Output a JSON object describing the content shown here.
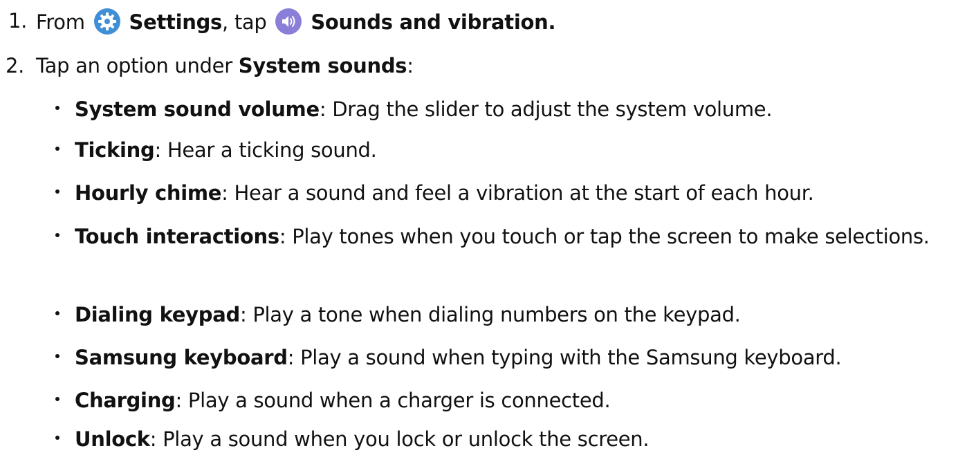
{
  "step1": {
    "number": "1.",
    "from_text": "From",
    "settings_label": "Settings",
    "tap_text": ", tap",
    "sounds_label": "Sounds and vibration.",
    "settings_icon": "gear-icon",
    "sounds_icon": "speaker-icon",
    "settings_icon_color": "#3f8fd6",
    "sounds_icon_color": "#8a7fd8"
  },
  "step2": {
    "number": "2.",
    "text": "Tap an option under ",
    "bold": "System sounds",
    "colon": ":"
  },
  "options": [
    {
      "term": "System sound volume",
      "desc": ": Drag the slider to adjust the system volume."
    },
    {
      "term": "Ticking",
      "desc": ": Hear a ticking sound."
    },
    {
      "term": "Hourly chime",
      "desc": ": Hear a sound and feel a vibration at the start of each hour."
    },
    {
      "term": "Touch interactions",
      "desc": ": Play tones when you touch or tap the screen to make selections."
    },
    {
      "term": "Dialing keypad",
      "desc": ": Play a tone when dialing numbers on the keypad."
    },
    {
      "term": "Samsung keyboard",
      "desc": ": Play a sound when typing with the Samsung keyboard."
    },
    {
      "term": "Charging",
      "desc": ": Play a sound when a charger is connected."
    },
    {
      "term": "Unlock",
      "desc": ": Play a sound when you lock or unlock the screen."
    }
  ]
}
